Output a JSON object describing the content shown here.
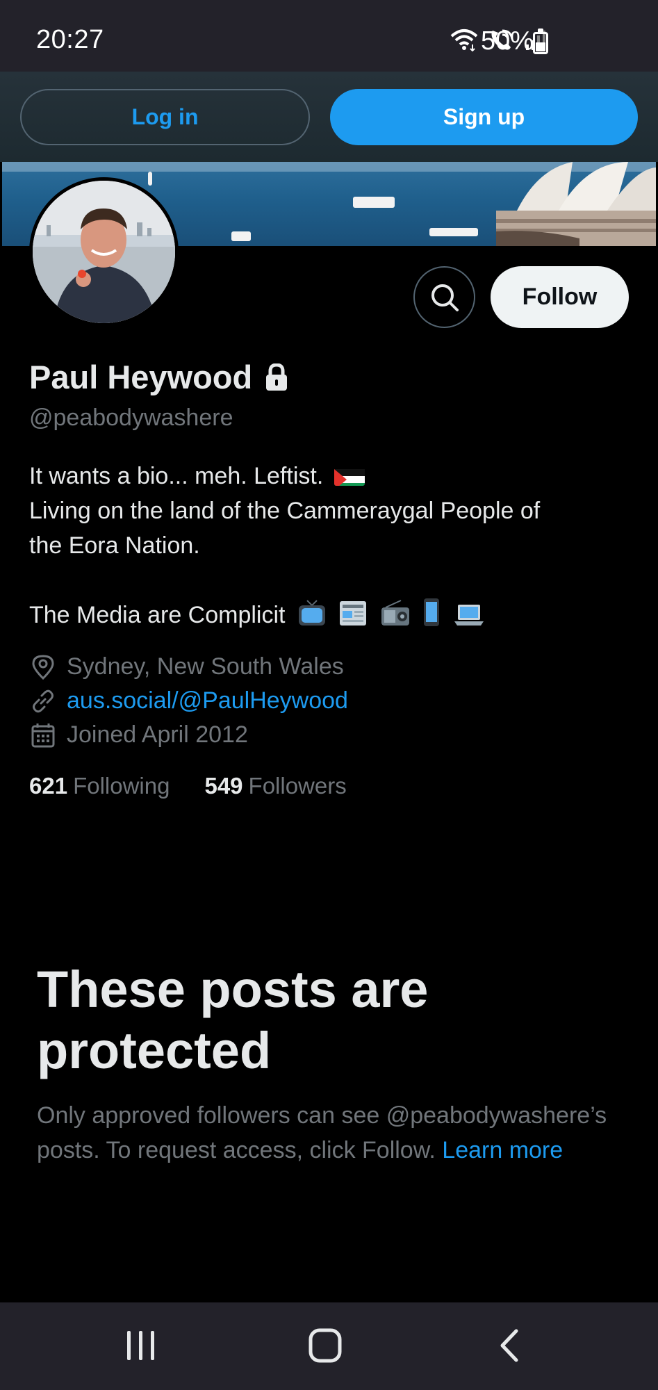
{
  "status_bar": {
    "time": "20:27",
    "battery": "50%",
    "battery_level": 0.5,
    "icons": [
      "wifi-icon",
      "wifi-calling-icon",
      "signal-icon",
      "battery-icon"
    ]
  },
  "auth": {
    "login_label": "Log in",
    "signup_label": "Sign up"
  },
  "profile": {
    "name": "Paul Heywood",
    "locked": true,
    "handle": "@peabodywashere",
    "follow_label": "Follow",
    "bio": {
      "line1": "It wants a bio... meh. Leftist.",
      "line1_emoji": "palestine-flag",
      "line2": "Living on the land of the Cammeraygal People of",
      "line3": "the Eora Nation.",
      "line4": "The Media are Complicit",
      "line4_emojis": [
        "television",
        "newspaper",
        "radio",
        "mobile-phone",
        "laptop"
      ]
    },
    "location": "Sydney, New South Wales",
    "website": "aus.social/@PaulHeywood",
    "joined": "Joined April 2012",
    "following_count": "621",
    "following_label": "Following",
    "followers_count": "549",
    "followers_label": "Followers"
  },
  "protected": {
    "title": "These posts are protected",
    "body": "Only approved followers can see @peabodywashere’s posts. To request access, click Follow.",
    "learn_more": "Learn more"
  },
  "nav": {
    "items": [
      "recents-icon",
      "home-icon",
      "back-icon"
    ]
  },
  "colors": {
    "accent": "#1d9bf0",
    "background": "#000000",
    "muted_text": "#71767b",
    "primary_text": "#e7e9ea"
  }
}
